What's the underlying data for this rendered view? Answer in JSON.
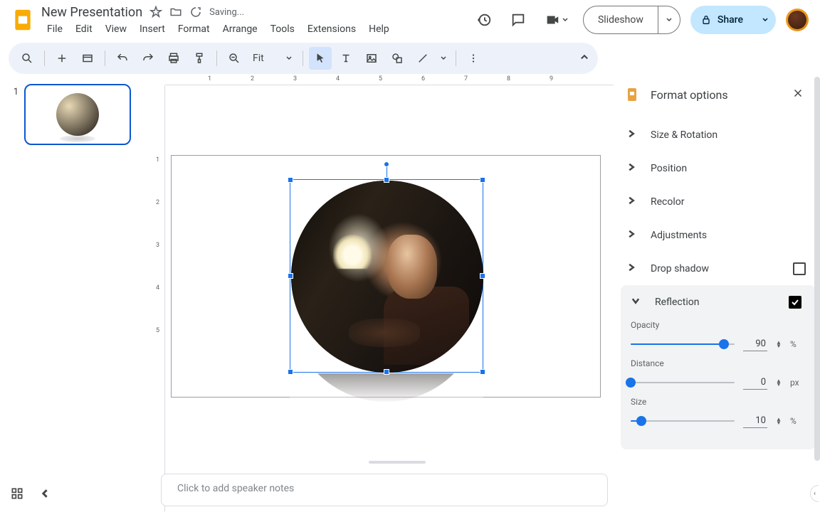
{
  "header": {
    "doc_title": "New Presentation",
    "saving": "Saving...",
    "menu": [
      "File",
      "Edit",
      "View",
      "Insert",
      "Format",
      "Arrange",
      "Tools",
      "Extensions",
      "Help"
    ],
    "slideshow": "Slideshow",
    "share": "Share"
  },
  "toolbar": {
    "zoom": "Fit"
  },
  "thumbs": {
    "num1": "1"
  },
  "ruler_h": [
    "1",
    "2",
    "3",
    "4",
    "5",
    "6",
    "7",
    "8",
    "9"
  ],
  "ruler_v": [
    "1",
    "2",
    "3",
    "4",
    "5"
  ],
  "notes": {
    "placeholder": "Click to add speaker notes"
  },
  "format_panel": {
    "title": "Format options",
    "sections": {
      "size_rotation": "Size & Rotation",
      "position": "Position",
      "recolor": "Recolor",
      "adjustments": "Adjustments",
      "drop_shadow": "Drop shadow",
      "reflection": "Reflection"
    },
    "reflection": {
      "opacity_label": "Opacity",
      "opacity_value": "90",
      "opacity_unit": "%",
      "distance_label": "Distance",
      "distance_value": "0",
      "distance_unit": "px",
      "size_label": "Size",
      "size_value": "10",
      "size_unit": "%"
    }
  }
}
